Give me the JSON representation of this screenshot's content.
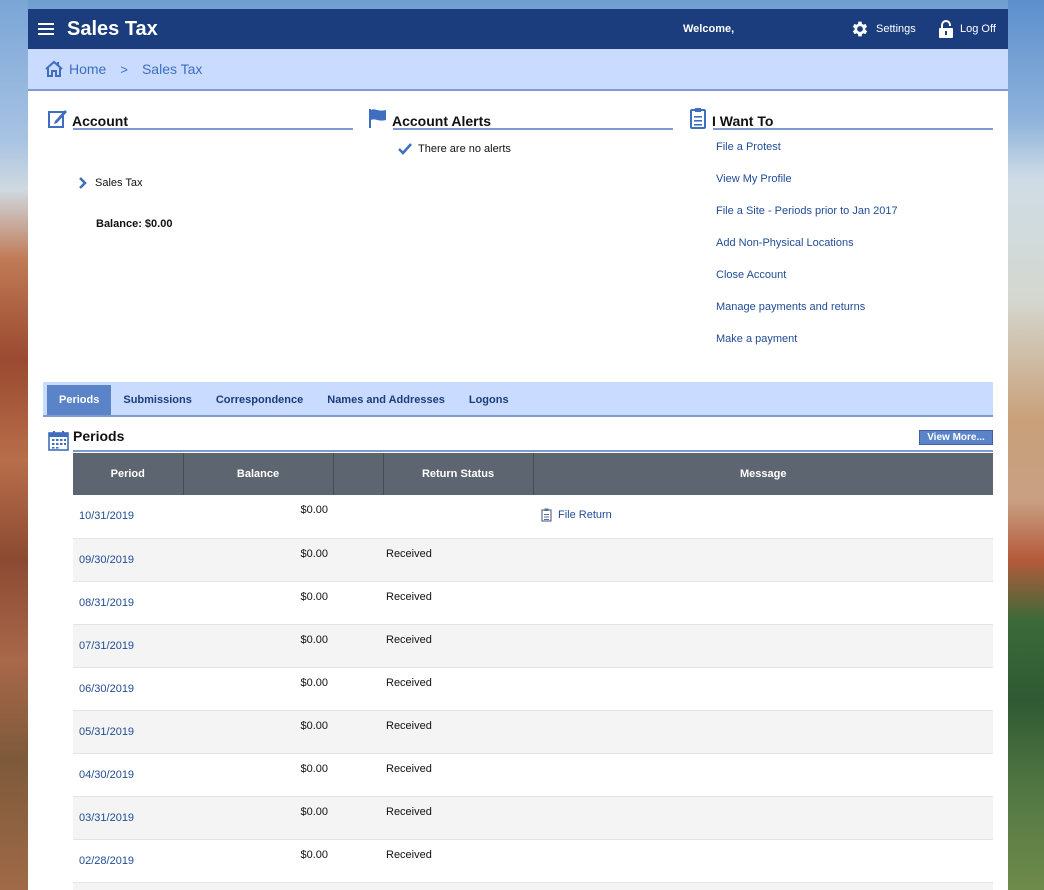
{
  "header": {
    "title": "Sales Tax",
    "welcome": "Welcome,",
    "settings_label": "Settings",
    "logoff_label": "Log Off"
  },
  "breadcrumb": {
    "home": "Home",
    "separator": ">",
    "current": "Sales Tax"
  },
  "account": {
    "heading": "Account",
    "item": "Sales Tax",
    "balance": "Balance: $0.00"
  },
  "alerts": {
    "heading": "Account Alerts",
    "message": "There are no alerts"
  },
  "want_to": {
    "heading": "I Want To",
    "links": [
      "File a Protest",
      "View My Profile",
      "File a Site - Periods prior to Jan 2017",
      "Add Non-Physical Locations",
      "Close Account",
      "Manage payments and returns",
      "Make a payment"
    ]
  },
  "tabs": [
    "Periods",
    "Submissions",
    "Correspondence",
    "Names and Addresses",
    "Logons"
  ],
  "periods": {
    "heading": "Periods",
    "view_more": "View More...",
    "columns": [
      "Period",
      "Balance",
      "",
      "Return Status",
      "Message"
    ],
    "rows": [
      {
        "period": "10/31/2019",
        "balance": "$0.00",
        "status": "",
        "message": "File Return"
      },
      {
        "period": "09/30/2019",
        "balance": "$0.00",
        "status": "Received",
        "message": ""
      },
      {
        "period": "08/31/2019",
        "balance": "$0.00",
        "status": "Received",
        "message": ""
      },
      {
        "period": "07/31/2019",
        "balance": "$0.00",
        "status": "Received",
        "message": ""
      },
      {
        "period": "06/30/2019",
        "balance": "$0.00",
        "status": "Received",
        "message": ""
      },
      {
        "period": "05/31/2019",
        "balance": "$0.00",
        "status": "Received",
        "message": ""
      },
      {
        "period": "04/30/2019",
        "balance": "$0.00",
        "status": "Received",
        "message": ""
      },
      {
        "period": "03/31/2019",
        "balance": "$0.00",
        "status": "Received",
        "message": ""
      },
      {
        "period": "02/28/2019",
        "balance": "$0.00",
        "status": "Received",
        "message": ""
      }
    ]
  },
  "colors": {
    "topbar": "#1b3d7d",
    "breadcrumb_bg": "#c9dcff",
    "accent": "#5a83c8",
    "link": "#1f4c94",
    "table_header": "#5d6670"
  },
  "icons": {
    "menu": "hamburger-icon",
    "settings": "gear-icon",
    "logoff": "lock-icon",
    "home": "home-icon",
    "account": "edit-icon",
    "alerts": "flag-icon",
    "want_to": "clipboard-icon",
    "periods": "calendar-icon",
    "check": "checkmark-icon",
    "chevron": "chevron-right-icon"
  }
}
